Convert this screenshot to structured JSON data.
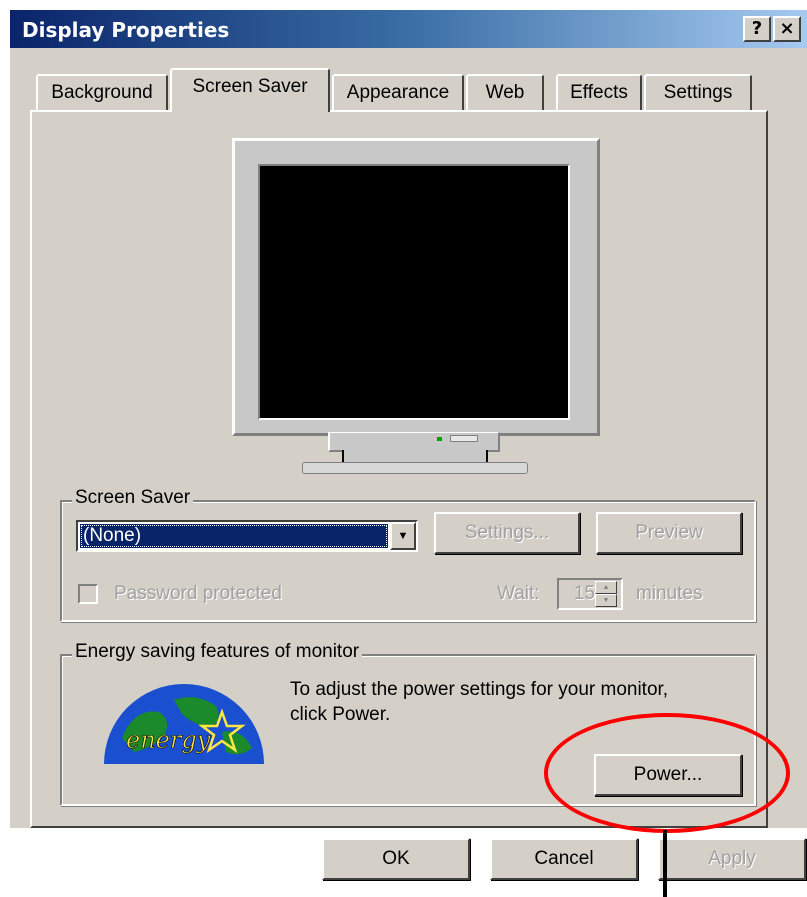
{
  "window": {
    "title": "Display Properties",
    "help_button": "?",
    "close_button": "×"
  },
  "tabs": [
    {
      "label": "Background",
      "active": false
    },
    {
      "label": "Screen Saver",
      "active": true
    },
    {
      "label": "Appearance",
      "active": false
    },
    {
      "label": "Web",
      "active": false
    },
    {
      "label": "Effects",
      "active": false
    },
    {
      "label": "Settings",
      "active": false
    }
  ],
  "screen_saver": {
    "group_label": "Screen Saver",
    "selected": "(None)",
    "settings_button": "Settings...",
    "preview_button": "Preview",
    "password_label": "Password protected",
    "password_checked": false,
    "wait_label": "Wait:",
    "wait_value": "15",
    "wait_units": "minutes"
  },
  "energy": {
    "group_label": "Energy saving features of monitor",
    "description_line1": "To adjust the power settings for your monitor,",
    "description_line2": "click Power.",
    "power_button": "Power...",
    "logo_text": "energy"
  },
  "footer": {
    "ok_button": "OK",
    "cancel_button": "Cancel",
    "apply_button": "Apply"
  },
  "colors": {
    "title_bar_start": "#0a246a",
    "title_bar_end": "#a6caf0",
    "dialog_face": "#d4d0c8",
    "selection": "#0a246a",
    "annotation": "#ff0000"
  }
}
